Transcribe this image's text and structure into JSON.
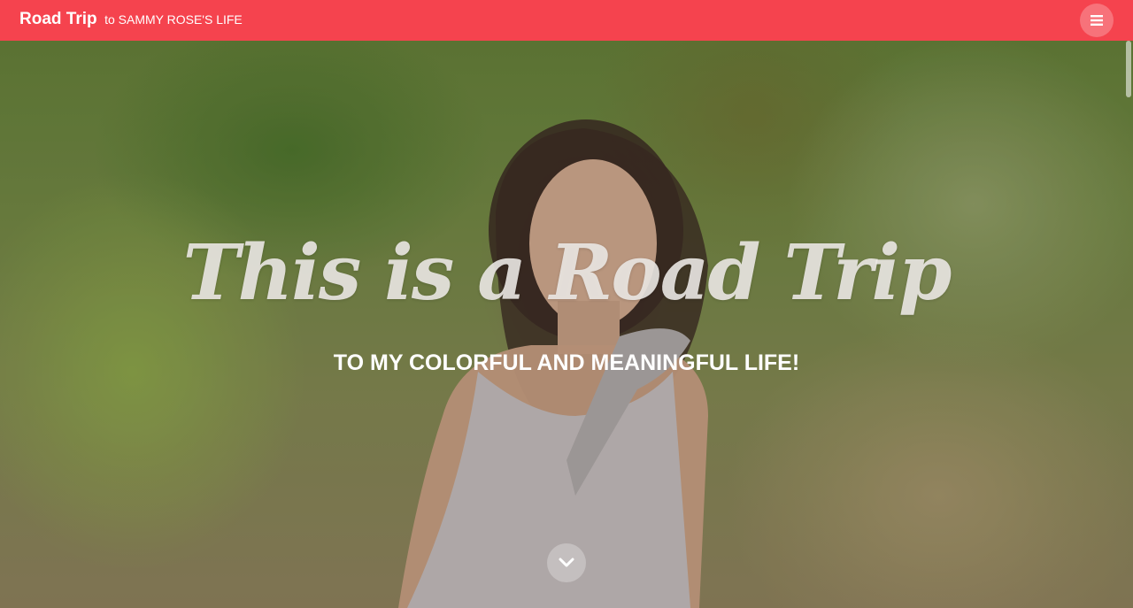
{
  "navbar": {
    "brand_main": "Road Trip",
    "brand_sub": "to SAMMY ROSE'S LIFE",
    "menu_icon": "hamburger-menu-icon",
    "color": "#f5434e"
  },
  "hero": {
    "title": "This is a Road Trip",
    "subtitle": "TO MY COLORFUL AND MEANINGFUL LIFE!",
    "scroll_icon": "chevron-down-icon"
  }
}
